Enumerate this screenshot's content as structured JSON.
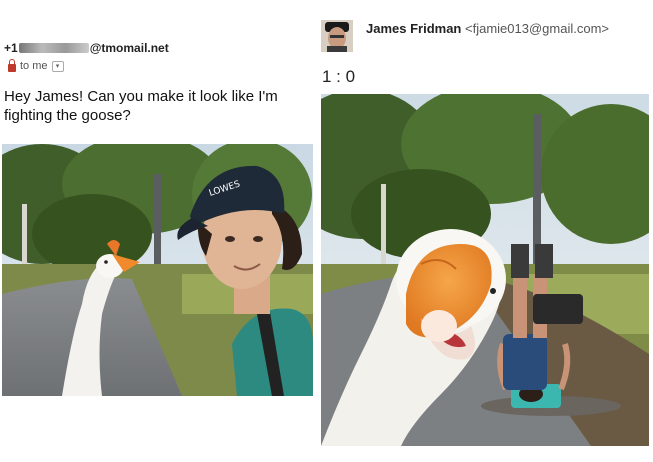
{
  "email": {
    "sender_prefix": "+1",
    "sender_suffix": "@tmomail.net",
    "recipient_label": "to me",
    "message": "Hey James! Can you make it look like I'm fighting the goose?"
  },
  "reply": {
    "name": "James Fridman",
    "email": "<fjamie013@gmail.com>",
    "score": "1 : 0"
  },
  "photo_left": {
    "hat_text": "LOWES"
  },
  "icons": {
    "lock": "lock-icon",
    "dropdown": "chevron-down-icon"
  },
  "colors": {
    "lock_red": "#c0392b",
    "text": "#222222"
  }
}
